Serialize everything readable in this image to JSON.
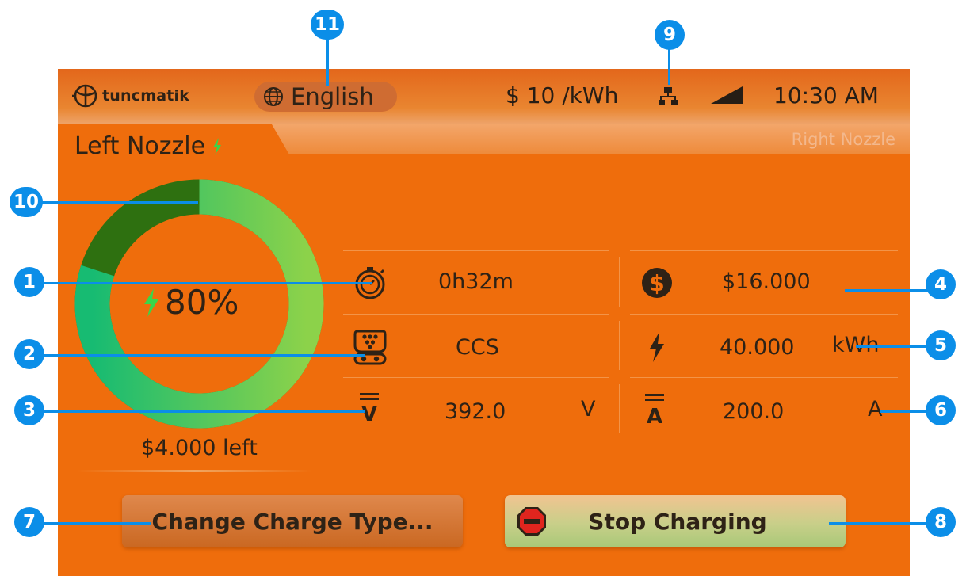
{
  "header": {
    "logo_text": "tuncmatik",
    "language": "English",
    "price": "$ 10 /kWh",
    "time": "10:30 AM"
  },
  "tabs": {
    "left": "Left Nozzle",
    "right": "Right Nozzle"
  },
  "gauge": {
    "percent_text": "80%",
    "fill_fraction": 0.8,
    "remaining_text": "$4.000 left",
    "colors": {
      "filled": "#2ecc71",
      "remaining": "#2e7010"
    }
  },
  "stats": {
    "duration": "0h32m",
    "connector": "CCS",
    "voltage": "392.0",
    "voltage_unit": "V",
    "cost": "$16.000",
    "energy": "40.000",
    "energy_unit": "kWh",
    "current": "200.0",
    "current_unit": "A"
  },
  "buttons": {
    "change_type": "Change Charge Type...",
    "stop": "Stop Charging"
  },
  "callouts": [
    "1",
    "2",
    "3",
    "4",
    "5",
    "6",
    "7",
    "8",
    "9",
    "10",
    "11"
  ],
  "colors": {
    "screen_bg": "#ef6d0c",
    "callout": "#0b8ee8",
    "text": "#2e2216"
  }
}
